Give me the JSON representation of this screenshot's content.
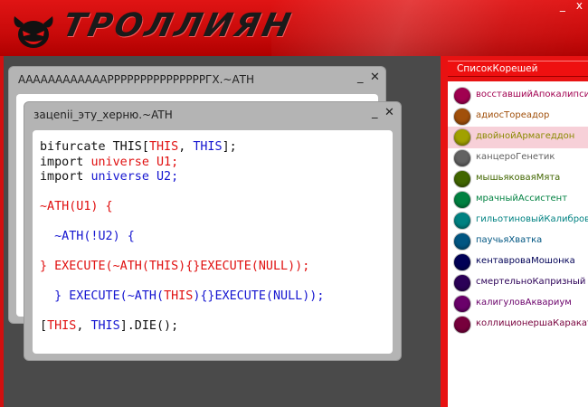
{
  "app": {
    "title": "ТРОЛЛИЯН",
    "minimize": "_",
    "close": "x"
  },
  "windows": [
    {
      "title": "ААААААААААААРРРРРРРРРРРРРРРГХ.~АТН",
      "minimize": "_",
      "close": "✕"
    },
    {
      "title": "зацеnii_эту_херню.~ATH",
      "minimize": "_",
      "close": "✕",
      "code": [
        [
          {
            "t": "bifurcate THIS["
          },
          {
            "t": "THIS",
            "c": "r"
          },
          {
            "t": ", "
          },
          {
            "t": "THIS",
            "c": "b"
          },
          {
            "t": "];"
          }
        ],
        [
          {
            "t": "import "
          },
          {
            "t": "universe U1;",
            "c": "r"
          }
        ],
        [
          {
            "t": "import "
          },
          {
            "t": "universe U2;",
            "c": "b"
          }
        ],
        [],
        [
          {
            "t": "~ATH(U1) {",
            "c": "r"
          }
        ],
        [],
        [
          {
            "t": "  ~ATH(!U2) {",
            "c": "b"
          }
        ],
        [],
        [
          {
            "t": "} EXECUTE(~ATH(THIS){}EXECUTE(NULL));",
            "c": "r"
          }
        ],
        [],
        [
          {
            "t": "  } EXECUTE(~ATH(",
            "c": "b"
          },
          {
            "t": "THIS",
            "c": "r"
          },
          {
            "t": "){}EXECUTE(NULL));",
            "c": "b"
          }
        ],
        [],
        [
          {
            "t": "["
          },
          {
            "t": "THIS",
            "c": "r"
          },
          {
            "t": ", "
          },
          {
            "t": "THIS",
            "c": "b"
          },
          {
            "t": "].DIE();"
          }
        ]
      ]
    }
  ],
  "chumroll": {
    "header": "СписокКорешей",
    "items": [
      {
        "name": "восставшийАпокалипсис",
        "color": "#a10050",
        "label_color": "#a10050",
        "selected": false
      },
      {
        "name": "адиосТореадор",
        "color": "#a1500b",
        "label_color": "#a1500b",
        "selected": false
      },
      {
        "name": "двойнойАрмагеддон",
        "color": "#a1a100",
        "label_color": "#8a8a00",
        "selected": true
      },
      {
        "name": "канцероГенетик",
        "color": "#626262",
        "label_color": "#626262",
        "selected": false
      },
      {
        "name": "мышьяковаяМята",
        "color": "#416600",
        "label_color": "#416600",
        "selected": false
      },
      {
        "name": "мрачныйАссистент",
        "color": "#008141",
        "label_color": "#008141",
        "selected": false
      },
      {
        "name": "гильотиновыйКалибровщик",
        "color": "#008282",
        "label_color": "#008282",
        "selected": false
      },
      {
        "name": "паучьяХватка",
        "color": "#005682",
        "label_color": "#005682",
        "selected": false
      },
      {
        "name": "кентавроваМошонка",
        "color": "#000056",
        "label_color": "#000056",
        "selected": false
      },
      {
        "name": "смертельноКапризный",
        "color": "#2b0057",
        "label_color": "#2b0057",
        "selected": false
      },
      {
        "name": "калигуловАквариум",
        "color": "#6a006a",
        "label_color": "#6a006a",
        "selected": false
      },
      {
        "name": "коллиционершаКаракатиц",
        "color": "#77003c",
        "label_color": "#77003c",
        "selected": false
      }
    ]
  }
}
